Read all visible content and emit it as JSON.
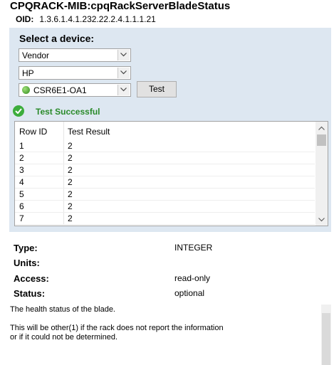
{
  "header": {
    "title": "CPQRACK-MIB:cpqRackServerBladeStatus",
    "oid_label": "OID:",
    "oid_value": "1.3.6.1.4.1.232.22.2.4.1.1.1.21"
  },
  "device_panel": {
    "label": "Select a device:",
    "vendor_combo": "Vendor",
    "brand_combo": "HP",
    "device_combo": "CSR6E1-OA1",
    "test_button": "Test",
    "status_text": "Test Successful"
  },
  "results": {
    "columns": [
      "Row ID",
      "Test Result"
    ],
    "rows": [
      {
        "id": "1",
        "result": "2"
      },
      {
        "id": "2",
        "result": "2"
      },
      {
        "id": "3",
        "result": "2"
      },
      {
        "id": "4",
        "result": "2"
      },
      {
        "id": "5",
        "result": "2"
      },
      {
        "id": "6",
        "result": "2"
      },
      {
        "id": "7",
        "result": "2"
      }
    ]
  },
  "properties": {
    "type_label": "Type:",
    "type_value": "INTEGER",
    "units_label": "Units:",
    "units_value": "",
    "access_label": "Access:",
    "access_value": "read-only",
    "status_label": "Status:",
    "status_value": "optional"
  },
  "description": {
    "line1": "The health status of the blade.",
    "line2": "This will be other(1) if the rack does not report the information",
    "line3": "or if it could not be determined."
  },
  "colors": {
    "panel_bg": "#dde7f1",
    "success_green": "#2a8a2a",
    "device_status": "#3cad3c"
  }
}
